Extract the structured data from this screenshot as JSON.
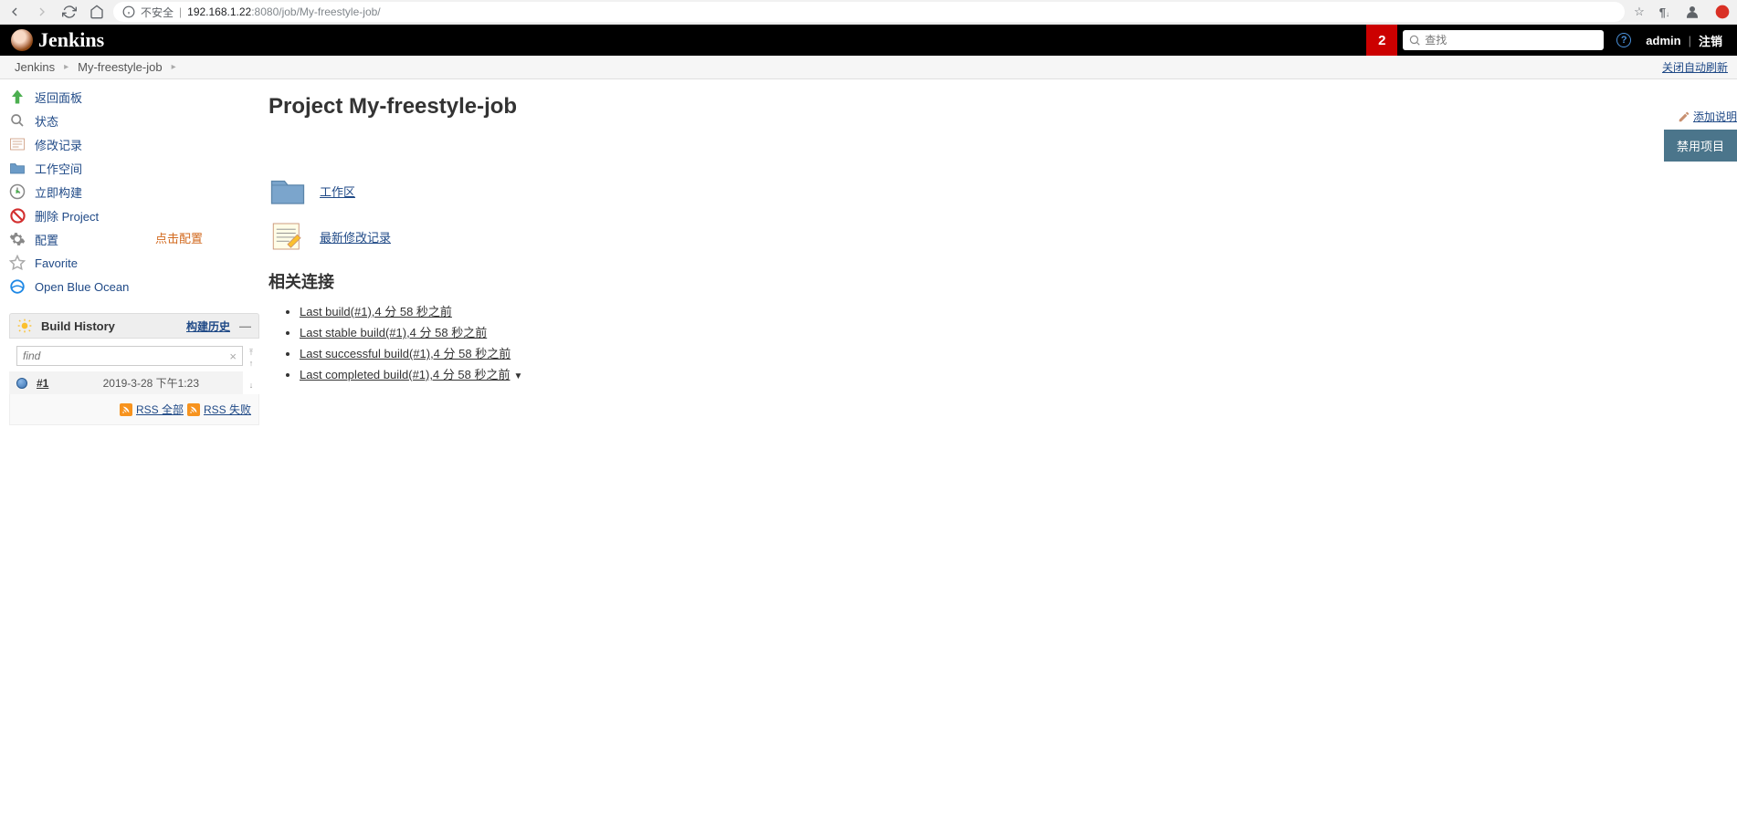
{
  "browser": {
    "insecure_label": "不安全",
    "sep": "|",
    "host": "192.168.1.22",
    "port": ":8080",
    "path": "/job/My-freestyle-job/"
  },
  "header": {
    "brand": "Jenkins",
    "notif_count": "2",
    "search_placeholder": "查找",
    "help": "?",
    "user": "admin",
    "sep": "|",
    "logout": "注销"
  },
  "breadcrumbs": {
    "items": [
      "Jenkins",
      "My-freestyle-job"
    ],
    "auto_refresh": "关闭自动刷新"
  },
  "sidebar": {
    "tasks": [
      {
        "label": "返回面板",
        "icon": "up-arrow"
      },
      {
        "label": "状态",
        "icon": "magnifier"
      },
      {
        "label": "修改记录",
        "icon": "changes"
      },
      {
        "label": "工作空间",
        "icon": "folder"
      },
      {
        "label": "立即构建",
        "icon": "clock-play"
      },
      {
        "label": "删除 Project",
        "icon": "no-entry"
      },
      {
        "label": "配置",
        "icon": "gear"
      },
      {
        "label": "Favorite",
        "icon": "star"
      },
      {
        "label": "Open Blue Ocean",
        "icon": "blue-circle"
      }
    ],
    "annotation": "点击配置"
  },
  "build_history": {
    "title": "Build History",
    "trend": "构建历史",
    "search_placeholder": "find",
    "builds": [
      {
        "num": "#1",
        "date": "2019-3-28 下午1:23"
      }
    ],
    "rss_all": "RSS 全部",
    "rss_fail": "RSS 失败"
  },
  "main": {
    "title": "Project My-freestyle-job",
    "add_desc": "添加说明",
    "disable_btn": "禁用项目",
    "workspace_link": "工作区",
    "changes_link": "最新修改记录",
    "related_title": "相关连接",
    "related": [
      "Last build(#1),4 分 58 秒之前",
      "Last stable build(#1),4 分 58 秒之前",
      "Last successful build(#1),4 分 58 秒之前",
      "Last completed build(#1),4 分 58 秒之前"
    ]
  }
}
